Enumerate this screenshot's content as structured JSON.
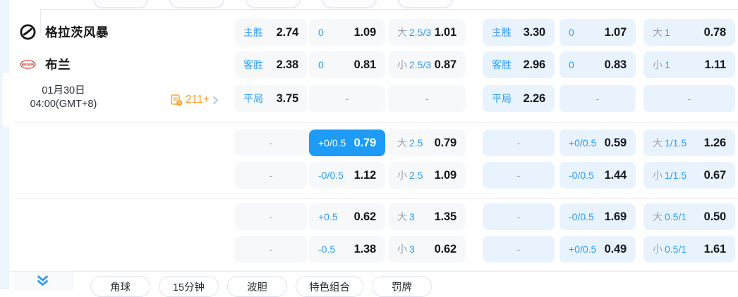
{
  "colors": {
    "selected_bg": "#1d9bf6",
    "label_blue": "#2e9cf5",
    "prefix_gray": "#9aa0ab",
    "orange": "#ff9c27",
    "cell_bg_left": "#f6f8fa",
    "cell_bg_right": "#e9f3fd"
  },
  "match": {
    "home_name": "格拉茨风暴",
    "away_name": "布兰",
    "date": "01月30日",
    "time": "04:00(GMT+8)",
    "markets_count": "211+"
  },
  "dash_char": "-",
  "odds": {
    "rows": [
      {
        "cells": [
          {
            "label": "主胜",
            "value": "2.74"
          },
          {
            "label": "0",
            "value": "1.09"
          },
          {
            "prefix": "大",
            "label": "2.5/3",
            "value": "1.01"
          },
          {
            "label": "主胜",
            "value": "3.30"
          },
          {
            "label": "0",
            "value": "1.07"
          },
          {
            "prefix": "大",
            "label": "1",
            "value": "0.78"
          }
        ]
      },
      {
        "cells": [
          {
            "label": "客胜",
            "value": "2.38"
          },
          {
            "label": "0",
            "value": "0.81"
          },
          {
            "prefix": "小",
            "label": "2.5/3",
            "value": "0.87"
          },
          {
            "label": "客胜",
            "value": "2.96"
          },
          {
            "label": "0",
            "value": "0.83"
          },
          {
            "prefix": "小",
            "label": "1",
            "value": "1.11"
          }
        ]
      },
      {
        "cells": [
          {
            "label": "平局",
            "value": "3.75"
          },
          {
            "dash": true
          },
          {
            "dash": true
          },
          {
            "label": "平局",
            "value": "2.26"
          },
          {
            "dash": true
          },
          {
            "dash": true
          }
        ]
      },
      {
        "cells": [
          {
            "dash": true
          },
          {
            "label": "+0/0.5",
            "value": "0.79",
            "selected": true
          },
          {
            "prefix": "大",
            "label": "2.5",
            "value": "0.79"
          },
          {
            "dash": true
          },
          {
            "label": "+0/0.5",
            "value": "0.59"
          },
          {
            "prefix": "大",
            "label": "1/1.5",
            "value": "1.26"
          }
        ]
      },
      {
        "cells": [
          {
            "dash": true
          },
          {
            "label": "-0/0.5",
            "value": "1.12"
          },
          {
            "prefix": "小",
            "label": "2.5",
            "value": "1.09"
          },
          {
            "dash": true
          },
          {
            "label": "-0/0.5",
            "value": "1.44"
          },
          {
            "prefix": "小",
            "label": "1/1.5",
            "value": "0.67"
          }
        ]
      },
      {
        "cells": [
          {
            "dash": true
          },
          {
            "label": "+0.5",
            "value": "0.62"
          },
          {
            "prefix": "大",
            "label": "3",
            "value": "1.35"
          },
          {
            "dash": true
          },
          {
            "label": "-0/0.5",
            "value": "1.69"
          },
          {
            "prefix": "大",
            "label": "0.5/1",
            "value": "0.50"
          }
        ]
      },
      {
        "cells": [
          {
            "dash": true
          },
          {
            "label": "-0.5",
            "value": "1.38"
          },
          {
            "prefix": "小",
            "label": "3",
            "value": "0.62"
          },
          {
            "dash": true
          },
          {
            "label": "+0/0.5",
            "value": "0.49"
          },
          {
            "prefix": "小",
            "label": "0.5/1",
            "value": "1.61"
          }
        ]
      }
    ]
  },
  "bottom_tabs": [
    "角球",
    "15分钟",
    "波胆",
    "特色组合",
    "罚牌"
  ]
}
